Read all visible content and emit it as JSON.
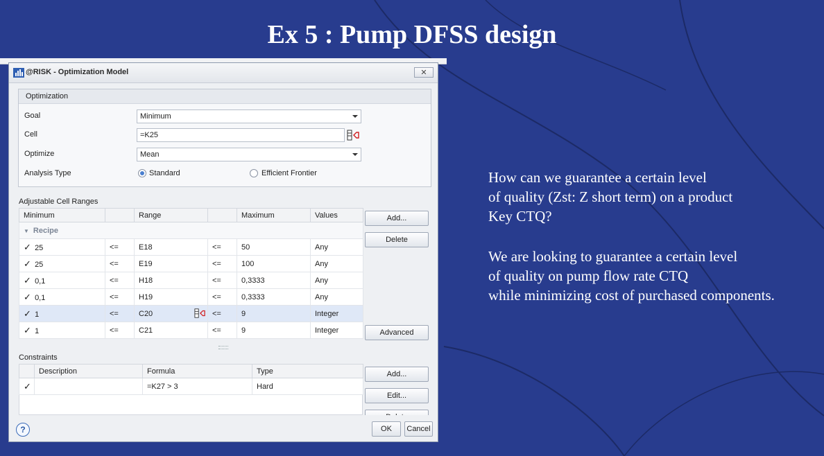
{
  "slide": {
    "title": "Ex 5 : Pump DFSS design",
    "paragraphs": [
      "How can we guarantee a certain level\nof quality (Zst: Z short term) on a product\nKey CTQ?",
      "We are looking to guarantee a certain level\nof quality on pump flow rate CTQ\nwhile minimizing cost of purchased components."
    ]
  },
  "dialog": {
    "title": "@RISK - Optimization Model",
    "close_label": "✕",
    "optimization": {
      "header": "Optimization",
      "goal_label": "Goal",
      "goal_value": "Minimum",
      "cell_label": "Cell",
      "cell_value": "=K25",
      "optimize_label": "Optimize",
      "optimize_value": "Mean",
      "analysis_label": "Analysis Type",
      "analysis_opt1": "Standard",
      "analysis_opt2": "Efficient Frontier"
    },
    "adjustable": {
      "label": "Adjustable Cell Ranges",
      "headers": [
        "Minimum",
        "",
        "Range",
        "",
        "Maximum",
        "Values"
      ],
      "group_name": "Recipe",
      "rows": [
        {
          "min": "25",
          "op1": "<=",
          "range": "E18",
          "op2": "<=",
          "max": "50",
          "values": "Any"
        },
        {
          "min": "25",
          "op1": "<=",
          "range": "E19",
          "op2": "<=",
          "max": "100",
          "values": "Any"
        },
        {
          "min": "0,1",
          "op1": "<=",
          "range": "H18",
          "op2": "<=",
          "max": "0,3333",
          "values": "Any"
        },
        {
          "min": "0,1",
          "op1": "<=",
          "range": "H19",
          "op2": "<=",
          "max": "0,3333",
          "values": "Any"
        },
        {
          "min": "1",
          "op1": "<=",
          "range": "C20",
          "op2": "<=",
          "max": "9",
          "values": "Integer"
        },
        {
          "min": "1",
          "op1": "<=",
          "range": "C21",
          "op2": "<=",
          "max": "9",
          "values": "Integer"
        }
      ],
      "add_label": "Add...",
      "delete_label": "Delete",
      "advanced_label": "Advanced"
    },
    "constraints": {
      "label": "Constraints",
      "headers": [
        "Description",
        "Formula",
        "Type"
      ],
      "rows": [
        {
          "description": "",
          "formula": "=K27 > 3",
          "type": "Hard"
        }
      ],
      "add_label": "Add...",
      "edit_label": "Edit...",
      "delete_label": "Delete"
    },
    "help_label": "?",
    "ok_label": "OK",
    "cancel_label": "Cancel"
  }
}
